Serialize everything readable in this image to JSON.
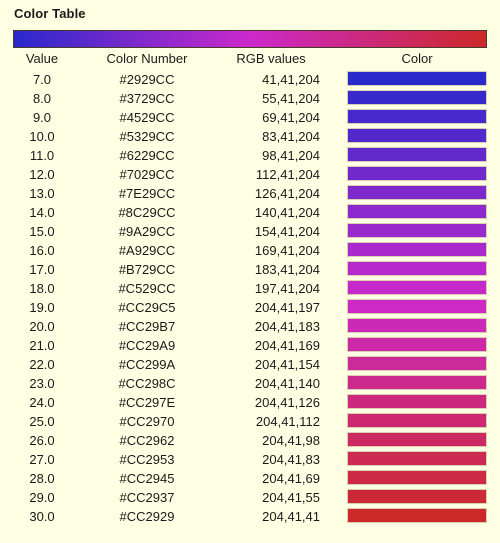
{
  "title": "Color Table",
  "ramp": {
    "name": "color-ramp-gradient",
    "start_color": "#2929CC",
    "mid_color": "#CC29CC",
    "end_color": "#CC2929",
    "border_color": "#4a3a2a"
  },
  "background_color": "#FFFFE4",
  "columns": {
    "value": "Value",
    "color_number": "Color Number",
    "rgb_values": "RGB values",
    "color": "Color"
  },
  "chart_data": {
    "type": "table",
    "title": "Color Table",
    "columns": [
      "Value",
      "Color Number",
      "RGB values",
      "Color"
    ],
    "values": [
      7.0,
      8.0,
      9.0,
      10.0,
      11.0,
      12.0,
      13.0,
      14.0,
      15.0,
      16.0,
      17.0,
      18.0,
      19.0,
      20.0,
      21.0,
      22.0,
      23.0,
      24.0,
      25.0,
      26.0,
      27.0,
      28.0,
      29.0,
      30.0
    ],
    "hex_colors": [
      "#2929CC",
      "#3729CC",
      "#4529CC",
      "#5329CC",
      "#6229CC",
      "#7029CC",
      "#7E29CC",
      "#8C29CC",
      "#9A29CC",
      "#A929CC",
      "#B729CC",
      "#C529CC",
      "#CC29C5",
      "#CC29B7",
      "#CC29A9",
      "#CC299A",
      "#CC298C",
      "#CC297E",
      "#CC2970",
      "#CC2962",
      "#CC2953",
      "#CC2945",
      "#CC2937",
      "#CC2929"
    ]
  },
  "rows": [
    {
      "value": "7.0",
      "number": "#2929CC",
      "rgb": "41,41,204",
      "color": "#2929CC"
    },
    {
      "value": "8.0",
      "number": "#3729CC",
      "rgb": "55,41,204",
      "color": "#3729CC"
    },
    {
      "value": "9.0",
      "number": "#4529CC",
      "rgb": "69,41,204",
      "color": "#4529CC"
    },
    {
      "value": "10.0",
      "number": "#5329CC",
      "rgb": "83,41,204",
      "color": "#5329CC"
    },
    {
      "value": "11.0",
      "number": "#6229CC",
      "rgb": "98,41,204",
      "color": "#6229CC"
    },
    {
      "value": "12.0",
      "number": "#7029CC",
      "rgb": "112,41,204",
      "color": "#7029CC"
    },
    {
      "value": "13.0",
      "number": "#7E29CC",
      "rgb": "126,41,204",
      "color": "#7E29CC"
    },
    {
      "value": "14.0",
      "number": "#8C29CC",
      "rgb": "140,41,204",
      "color": "#8C29CC"
    },
    {
      "value": "15.0",
      "number": "#9A29CC",
      "rgb": "154,41,204",
      "color": "#9A29CC"
    },
    {
      "value": "16.0",
      "number": "#A929CC",
      "rgb": "169,41,204",
      "color": "#A929CC"
    },
    {
      "value": "17.0",
      "number": "#B729CC",
      "rgb": "183,41,204",
      "color": "#B729CC"
    },
    {
      "value": "18.0",
      "number": "#C529CC",
      "rgb": "197,41,204",
      "color": "#C529CC"
    },
    {
      "value": "19.0",
      "number": "#CC29C5",
      "rgb": "204,41,197",
      "color": "#CC29C5"
    },
    {
      "value": "20.0",
      "number": "#CC29B7",
      "rgb": "204,41,183",
      "color": "#CC29B7"
    },
    {
      "value": "21.0",
      "number": "#CC29A9",
      "rgb": "204,41,169",
      "color": "#CC29A9"
    },
    {
      "value": "22.0",
      "number": "#CC299A",
      "rgb": "204,41,154",
      "color": "#CC299A"
    },
    {
      "value": "23.0",
      "number": "#CC298C",
      "rgb": "204,41,140",
      "color": "#CC298C"
    },
    {
      "value": "24.0",
      "number": "#CC297E",
      "rgb": "204,41,126",
      "color": "#CC297E"
    },
    {
      "value": "25.0",
      "number": "#CC2970",
      "rgb": "204,41,112",
      "color": "#CC2970"
    },
    {
      "value": "26.0",
      "number": "#CC2962",
      "rgb": "204,41,98",
      "color": "#CC2962"
    },
    {
      "value": "27.0",
      "number": "#CC2953",
      "rgb": "204,41,83",
      "color": "#CC2953"
    },
    {
      "value": "28.0",
      "number": "#CC2945",
      "rgb": "204,41,69",
      "color": "#CC2945"
    },
    {
      "value": "29.0",
      "number": "#CC2937",
      "rgb": "204,41,55",
      "color": "#CC2937"
    },
    {
      "value": "30.0",
      "number": "#CC2929",
      "rgb": "204,41,41",
      "color": "#CC2929"
    }
  ]
}
